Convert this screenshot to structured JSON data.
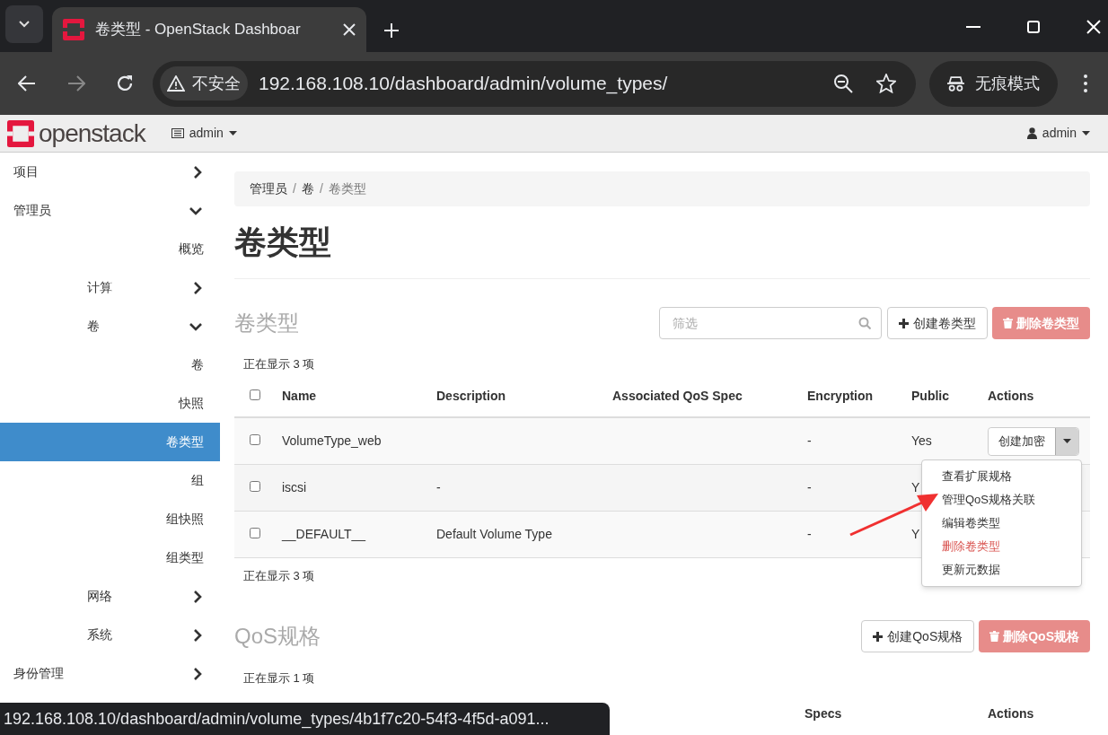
{
  "browser": {
    "tab_title": "卷类型 - OpenStack Dashboar",
    "security": "不安全",
    "url": "192.168.108.10/dashboard/admin/volume_types/",
    "incognito": "无痕模式"
  },
  "header": {
    "logo": "openstack",
    "project": "admin",
    "user": "admin"
  },
  "sidebar": {
    "items": [
      {
        "label": "项目",
        "expanded": false,
        "selected": false
      },
      {
        "label": "管理员",
        "expanded": true,
        "selected": false,
        "children": [
          {
            "label": "概览",
            "selected": false
          },
          {
            "label": "计算",
            "expanded": false,
            "selected": false
          },
          {
            "label": "卷",
            "expanded": true,
            "selected": false,
            "children": [
              {
                "label": "卷",
                "selected": false
              },
              {
                "label": "快照",
                "selected": false
              },
              {
                "label": "卷类型",
                "selected": true
              },
              {
                "label": "组",
                "selected": false
              },
              {
                "label": "组快照",
                "selected": false
              },
              {
                "label": "组类型",
                "selected": false
              }
            ]
          },
          {
            "label": "网络",
            "expanded": false,
            "selected": false
          },
          {
            "label": "系统",
            "expanded": false,
            "selected": false
          }
        ]
      },
      {
        "label": "身份管理",
        "expanded": false,
        "selected": false
      }
    ]
  },
  "breadcrumb": {
    "items": [
      "管理员",
      "卷",
      "卷类型"
    ],
    "separator": "/"
  },
  "page_title": "卷类型",
  "volume_types": {
    "heading": "卷类型",
    "filter": {
      "placeholder": "筛选"
    },
    "create_button": "创建卷类型",
    "delete_button": "删除卷类型",
    "count_top": "正在显示 3 项",
    "select_all": {
      "checked": false
    },
    "columns": [
      "Name",
      "Description",
      "Associated QoS Spec",
      "Encryption",
      "Public",
      "Actions"
    ],
    "rows": [
      {
        "checked": false,
        "name": "VolumeType_web",
        "encryption": "-",
        "public": "Yes",
        "action": "创建加密"
      },
      {
        "checked": false,
        "name": "iscsi",
        "description": "-",
        "encryption": "-",
        "public": "Y"
      },
      {
        "checked": false,
        "name": "__DEFAULT__",
        "description": "Default Volume Type",
        "encryption": "-",
        "public": "Y"
      }
    ],
    "count_bottom": "正在显示 3 项"
  },
  "action_menu": [
    {
      "label": "查看扩展规格",
      "kind": "normal"
    },
    {
      "label": "管理QoS规格关联",
      "kind": "normal"
    },
    {
      "label": "编辑卷类型",
      "kind": "normal"
    },
    {
      "label": "删除卷类型",
      "kind": "danger"
    },
    {
      "label": "更新元数据",
      "kind": "normal"
    }
  ],
  "qos_specs": {
    "heading": "QoS规格",
    "create_button": "创建QoS规格",
    "delete_button": "删除QoS规格",
    "count": "正在显示 1 项",
    "columns": [
      "Specs",
      "Actions"
    ]
  },
  "status_url": "192.168.108.10/dashboard/admin/volume_types/4b1f7c20-54f3-4f5d-a091..."
}
